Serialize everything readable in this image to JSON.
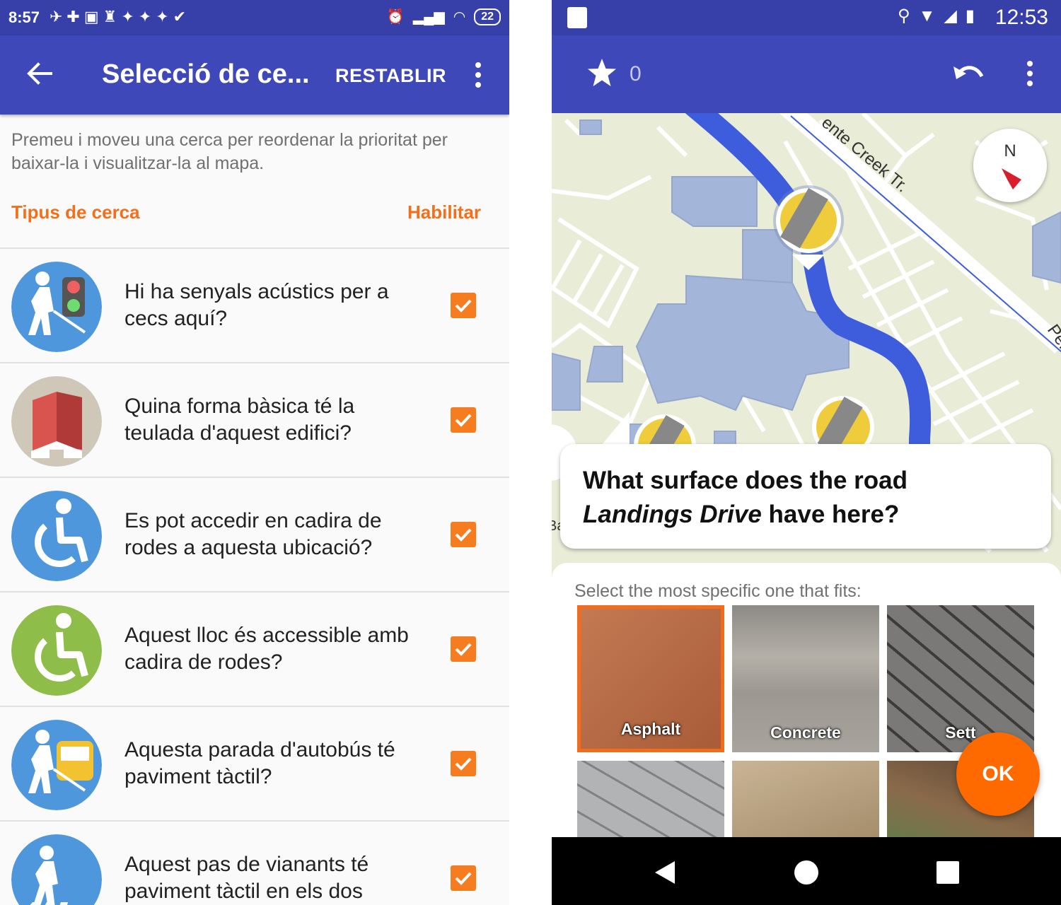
{
  "left": {
    "status_bar": {
      "time": "8:57",
      "battery": "22"
    },
    "app_bar": {
      "title": "Selecció de ce...",
      "action": "RESTABLIR"
    },
    "hint": "Premeu i moveu una cerca per reordenar la prioritat per baixar-la i visualitzar-la al mapa.",
    "header_left": "Tipus de cerca",
    "header_right": "Habilitar",
    "rows": [
      {
        "text": "Hi ha senyals acústics per a cecs aquí?",
        "icon": "blind-traffic-light-icon",
        "checked": true
      },
      {
        "text": "Quina forma bàsica té la teulada d'aquest edifici?",
        "icon": "roof-shape-icon",
        "checked": true
      },
      {
        "text": "Es pot accedir en cadira de rodes a aquesta ubicació?",
        "icon": "wheelchair-blue-icon",
        "checked": true
      },
      {
        "text": "Aquest lloc és accessible amb cadira de rodes?",
        "icon": "wheelchair-green-icon",
        "checked": true
      },
      {
        "text": "Aquesta parada d'autobús té paviment tàctil?",
        "icon": "blind-bus-stop-icon",
        "checked": true
      },
      {
        "text": "Aquest pas de vianants té paviment tàctil en els dos costats?",
        "icon": "blind-crosswalk-icon",
        "checked": true
      }
    ]
  },
  "right": {
    "status_bar": {
      "time": "12:53"
    },
    "app_bar": {
      "star_count": "0"
    },
    "map_labels": {
      "street": "ente Creek Tr.",
      "edge_right": "Per",
      "edge_left": "Ba",
      "compass": "N"
    },
    "question_line1": "What surface does the road",
    "question_road": "Landings Drive",
    "question_tail": " have here?",
    "instruction": "Select the most specific one that fits:",
    "options": [
      {
        "label": "Asphalt",
        "selected": true,
        "color": "#b86a45"
      },
      {
        "label": "Concrete",
        "selected": false,
        "color": "#9e9a93"
      },
      {
        "label": "Sett",
        "selected": false,
        "color": "#6f6e6c"
      },
      {
        "label": "",
        "selected": false,
        "color": "#a7a9aa"
      },
      {
        "label": "",
        "selected": false,
        "color": "#b9a387"
      },
      {
        "label": "",
        "selected": false,
        "color": "#6d5138"
      }
    ],
    "ok_label": "OK"
  },
  "colors": {
    "primary": "#3f48b8",
    "status": "#3640a8",
    "accent": "#f57c1f",
    "route": "#3d5ddc"
  }
}
